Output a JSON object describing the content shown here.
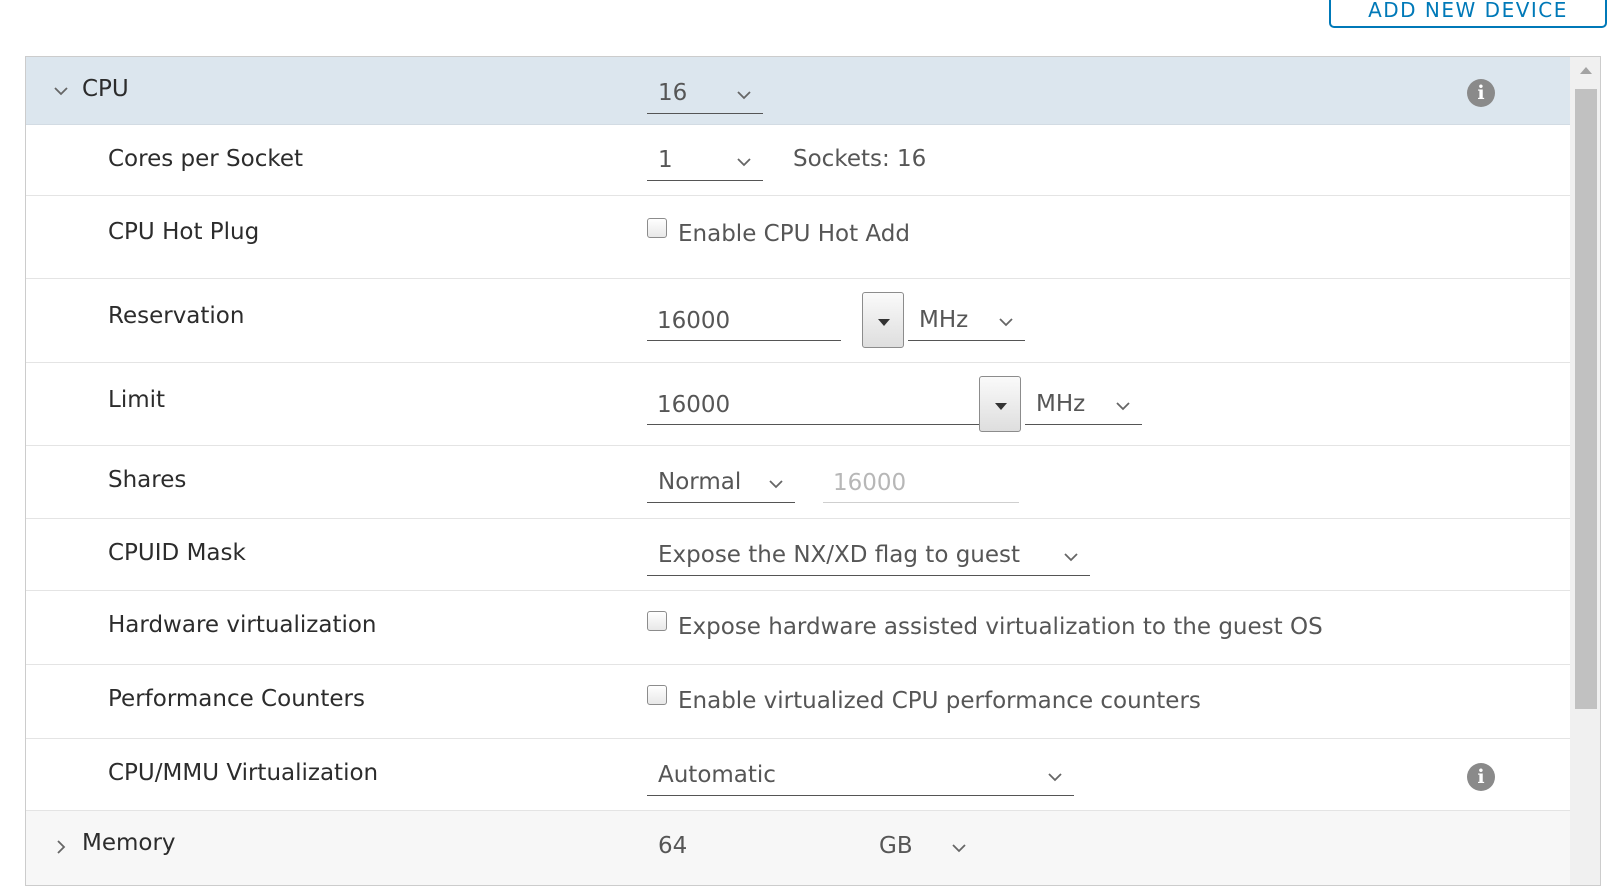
{
  "toolbar": {
    "add_device_label": "ADD NEW DEVICE"
  },
  "cpu": {
    "label": "CPU",
    "count": "16",
    "cores_per_socket": {
      "label": "Cores per Socket",
      "value": "1",
      "sockets_text": "Sockets: 16"
    },
    "hot_plug": {
      "label": "CPU Hot Plug",
      "checkbox_label": "Enable CPU Hot Add"
    },
    "reservation": {
      "label": "Reservation",
      "value": "16000",
      "unit": "MHz"
    },
    "limit": {
      "label": "Limit",
      "value": "16000",
      "unit": "MHz"
    },
    "shares": {
      "label": "Shares",
      "level": "Normal",
      "value": "16000"
    },
    "cpuid_mask": {
      "label": "CPUID Mask",
      "value": "Expose the NX/XD flag to guest"
    },
    "hw_virtualization": {
      "label": "Hardware virtualization",
      "checkbox_label": "Expose hardware assisted virtualization to the guest OS"
    },
    "perf_counters": {
      "label": "Performance Counters",
      "checkbox_label": "Enable virtualized CPU performance counters"
    },
    "mmu_virtualization": {
      "label": "CPU/MMU Virtualization",
      "value": "Automatic"
    }
  },
  "memory": {
    "label": "Memory",
    "value": "64",
    "unit": "GB"
  },
  "icons": {
    "info": "i"
  }
}
